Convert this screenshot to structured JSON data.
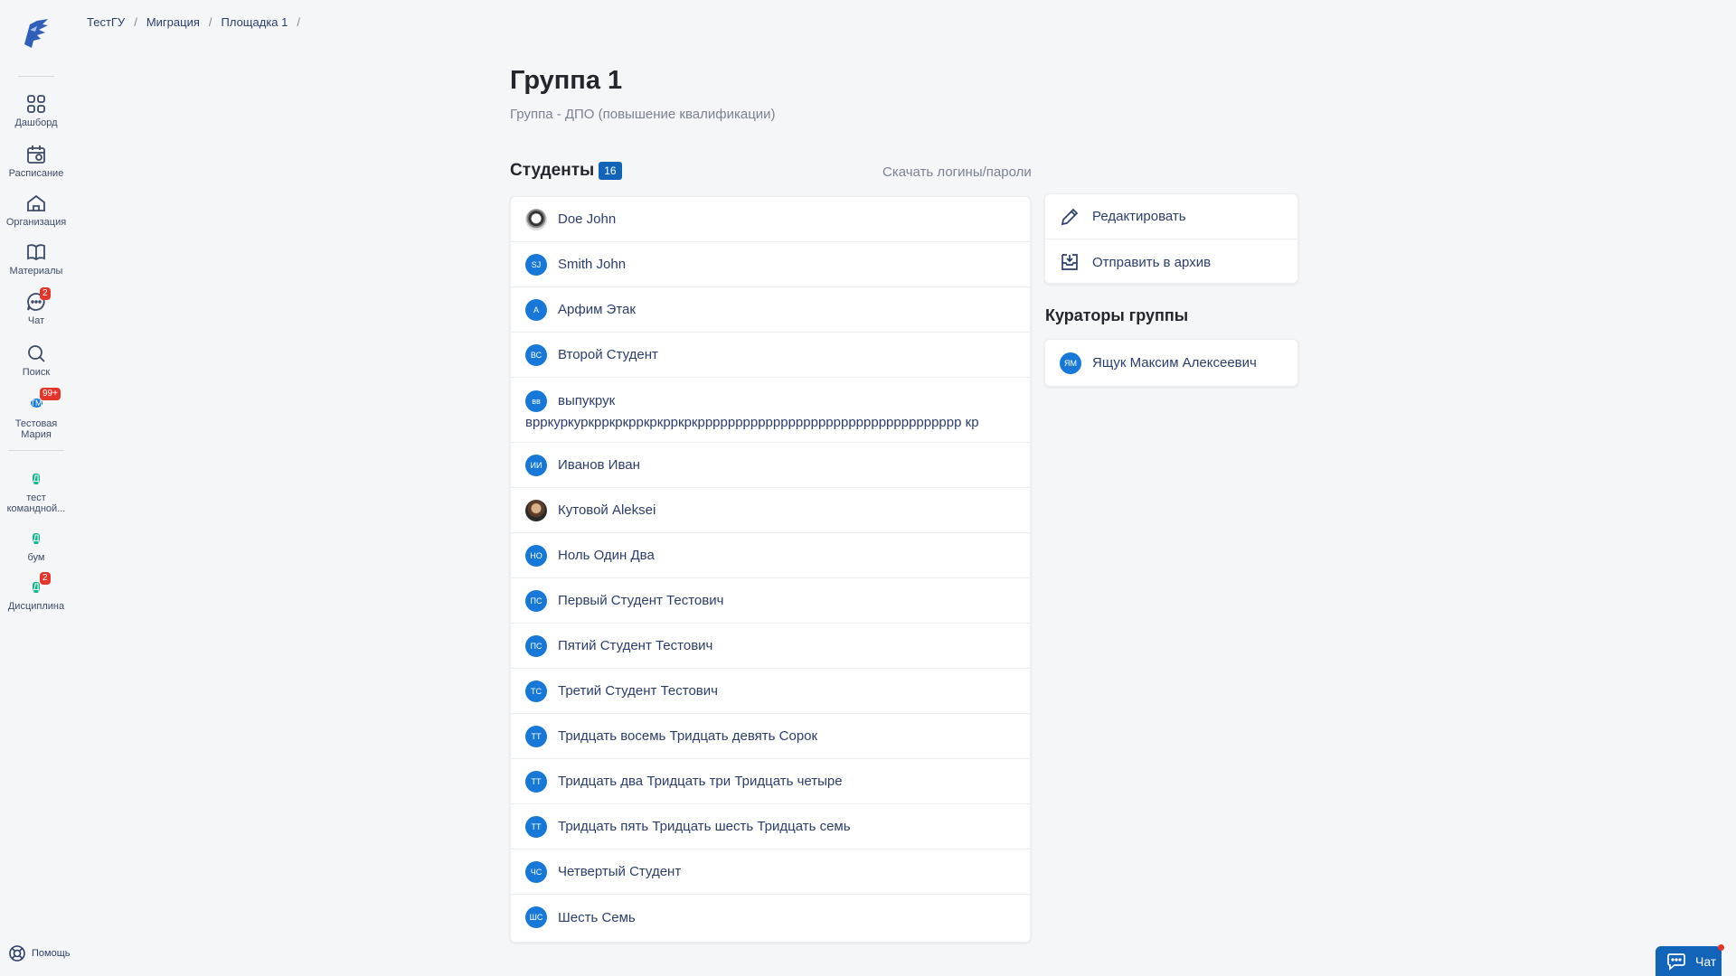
{
  "breadcrumb": [
    "ТестГУ",
    "Миграция",
    "Площадка 1"
  ],
  "sidebar": {
    "items": [
      {
        "label": "Дашборд",
        "icon": "grid-icon"
      },
      {
        "label": "Расписание",
        "icon": "calendar-icon"
      },
      {
        "label": "Организация",
        "icon": "home-icon"
      },
      {
        "label": "Материалы",
        "icon": "book-icon"
      },
      {
        "label": "Чат",
        "icon": "chat-icon",
        "badge": "2"
      },
      {
        "label": "Поиск",
        "icon": "search-icon"
      }
    ],
    "profile": {
      "initials": "ТМ",
      "name_line1": "Тестовая",
      "name_line2": "Мария",
      "badge": "99+"
    },
    "courses": [
      {
        "letter": "Д",
        "label_line1": "тест",
        "label_line2": "командной..."
      },
      {
        "letter": "Д",
        "label_line1": "бум"
      },
      {
        "letter": "Д",
        "label_line1": "Дисциплина",
        "badge": "2"
      }
    ],
    "help_label": "Помощь"
  },
  "page": {
    "title": "Группа 1",
    "subtitle": "Группа - ДПО (повышение квалификации)"
  },
  "students": {
    "title": "Студенты",
    "count": "16",
    "download_label": "Скачать логины/пароли",
    "items": [
      {
        "initials": "",
        "name": "Doe John",
        "photo": "a"
      },
      {
        "initials": "SJ",
        "name": "Smith John"
      },
      {
        "initials": "А",
        "name": "Арфим Этак"
      },
      {
        "initials": "ВС",
        "name": "Второй Студент"
      },
      {
        "initials": "вв",
        "name": "выпукрук",
        "name2": "врркуркуркрркркрркркрркркррррррррррррррррррррррррррррррррррр кр"
      },
      {
        "initials": "ИИ",
        "name": "Иванов Иван"
      },
      {
        "initials": "",
        "name": "Кутовой Aleksei",
        "photo": "b"
      },
      {
        "initials": "НО",
        "name": "Ноль Один Два"
      },
      {
        "initials": "ПС",
        "name": "Первый Студент Тестович"
      },
      {
        "initials": "ПС",
        "name": "Пятий Студент Тестович"
      },
      {
        "initials": "ТС",
        "name": "Третий Студент Тестович"
      },
      {
        "initials": "ТТ",
        "name": "Тридцать восемь Тридцать девять Сорок"
      },
      {
        "initials": "ТТ",
        "name": "Тридцать два Тридцать три Тридцать четыре"
      },
      {
        "initials": "ТТ",
        "name": "Тридцать пять Тридцать шесть Тридцать семь"
      },
      {
        "initials": "ЧС",
        "name": "Четвертый Студент"
      },
      {
        "initials": "ШС",
        "name": "Шесть Семь"
      }
    ]
  },
  "actions": {
    "edit_label": "Редактировать",
    "archive_label": "Отправить в архив"
  },
  "curators": {
    "title": "Кураторы группы",
    "items": [
      {
        "initials": "ЯМ",
        "name": "Ящук Максим Алексеевич"
      }
    ]
  },
  "chat_button": {
    "label": "Чат"
  },
  "colors": {
    "accent": "#1264b8",
    "avatar": "#1778d8",
    "course": "#17b58f",
    "badge": "#e5352b"
  }
}
